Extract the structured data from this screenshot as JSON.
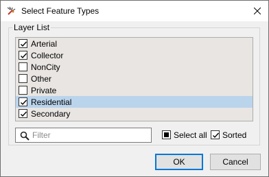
{
  "window": {
    "title": "Select Feature Types"
  },
  "group": {
    "label": "Layer List"
  },
  "layers": [
    {
      "label": "Arterial",
      "checked": true,
      "selected": false
    },
    {
      "label": "Collector",
      "checked": true,
      "selected": false
    },
    {
      "label": "NonCity",
      "checked": false,
      "selected": false
    },
    {
      "label": "Other",
      "checked": false,
      "selected": false
    },
    {
      "label": "Private",
      "checked": false,
      "selected": false
    },
    {
      "label": "Residential",
      "checked": true,
      "selected": true
    },
    {
      "label": "Secondary",
      "checked": true,
      "selected": false
    }
  ],
  "search": {
    "placeholder": "Filter",
    "value": ""
  },
  "options": {
    "select_all": {
      "label": "Select all",
      "state": "indeterminate"
    },
    "sorted": {
      "label": "Sorted",
      "checked": true
    }
  },
  "buttons": {
    "ok": "OK",
    "cancel": "Cancel"
  },
  "colors": {
    "selected_row": "#bad4ec",
    "list_bg": "#e8e5e2",
    "default_button_border": "#0078d7"
  }
}
